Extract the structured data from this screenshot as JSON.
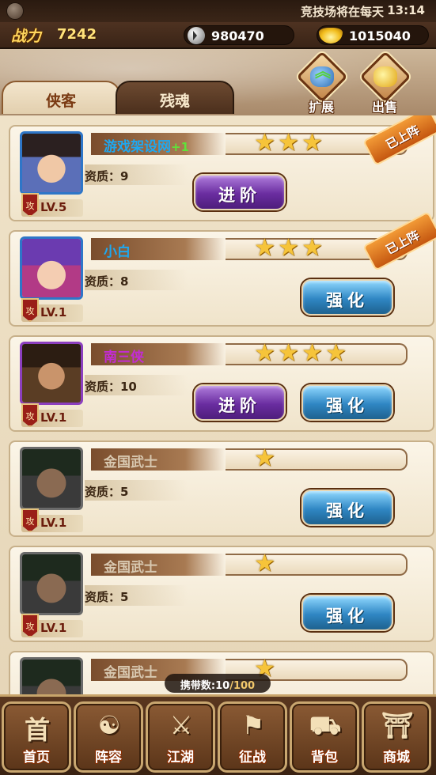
{
  "status_bar": {
    "ticker": "竞技场将在每天",
    "clock": "13:14"
  },
  "currency": {
    "power_label": "战力",
    "power_value": "7242",
    "silver": "980470",
    "gold": "1015040"
  },
  "tabs": [
    {
      "label": "侠客",
      "active": true
    },
    {
      "label": "残魂",
      "active": false
    }
  ],
  "actions": {
    "expand": "扩展",
    "sell": "出售"
  },
  "heroes": [
    {
      "name": "游戏架设网",
      "bonus": "+1",
      "stars": 3,
      "quality": "资质：9",
      "level": "LV.5",
      "attack_tag": "攻",
      "deployed": "已上阵",
      "advance": "进阶",
      "strengthen": ""
    },
    {
      "name": "小白",
      "bonus": "",
      "stars": 3,
      "quality": "资质：8",
      "level": "LV.1",
      "attack_tag": "攻",
      "deployed": "已上阵",
      "advance": "",
      "strengthen": "强化"
    },
    {
      "name": "南三侠",
      "bonus": "",
      "stars": 4,
      "quality": "资质：10",
      "level": "LV.1",
      "attack_tag": "攻",
      "deployed": "",
      "advance": "进阶",
      "strengthen": "强化"
    },
    {
      "name": "金国武士",
      "bonus": "",
      "stars": 1,
      "quality": "资质：5",
      "level": "LV.1",
      "attack_tag": "攻",
      "deployed": "",
      "advance": "",
      "strengthen": "强化"
    },
    {
      "name": "金国武士",
      "bonus": "",
      "stars": 1,
      "quality": "资质：5",
      "level": "LV.1",
      "attack_tag": "攻",
      "deployed": "",
      "advance": "",
      "strengthen": "强化"
    },
    {
      "name": "金国武士",
      "bonus": "",
      "stars": 1,
      "quality": "",
      "level": "",
      "attack_tag": "",
      "deployed": "",
      "advance": "",
      "strengthen": ""
    }
  ],
  "carry": {
    "label": "携带数:",
    "current": "10",
    "max": "/100"
  },
  "nav": [
    {
      "label": "首页",
      "glyph": "首",
      "icon": "home-icon"
    },
    {
      "label": "阵容",
      "glyph": "☯",
      "icon": "lineup-icon"
    },
    {
      "label": "江湖",
      "glyph": "⚔",
      "icon": "swords-icon"
    },
    {
      "label": "征战",
      "glyph": "⚑",
      "icon": "battle-icon"
    },
    {
      "label": "背包",
      "glyph": "⛟",
      "icon": "backpack-icon"
    },
    {
      "label": "商城",
      "glyph": "⛩",
      "icon": "shop-icon"
    }
  ],
  "colors": {
    "blue_name": "#1ea8f0",
    "purple_name": "#c42bd6",
    "grey_name": "#d8c8b0",
    "star": "#f6c43a"
  }
}
